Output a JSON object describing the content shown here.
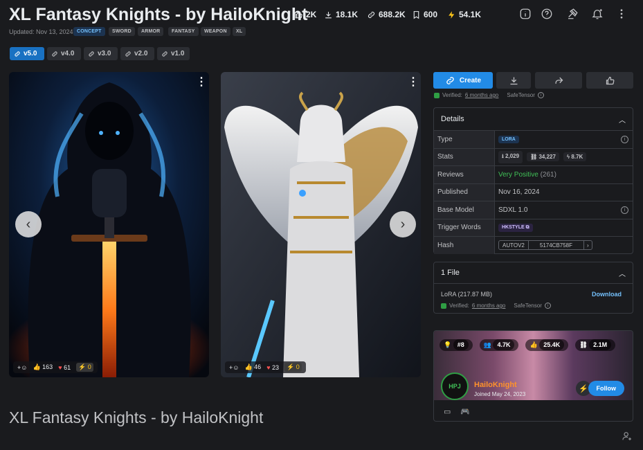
{
  "header": {
    "title": "XL Fantasy Knights - by HailoKnight",
    "stats": {
      "likes": "2K",
      "downloads": "18.1K",
      "generations": "688.2K",
      "bookmarks": "600",
      "buzz": "54.1K"
    },
    "updated": "Updated: Nov 13, 2024",
    "tags": [
      "CONCEPT",
      "SWORD",
      "ARMOR",
      "FANTASY",
      "WEAPON",
      "XL"
    ]
  },
  "versions": [
    "v5.0",
    "v4.0",
    "v3.0",
    "v2.0",
    "v1.0"
  ],
  "gallery": {
    "images": [
      {
        "likes": "163",
        "hearts": "61",
        "buzz": "0"
      },
      {
        "likes": "46",
        "hearts": "23",
        "buzz": "0"
      }
    ]
  },
  "actions": {
    "create": "Create"
  },
  "verified": {
    "label": "Verified:",
    "when": "6 months ago",
    "format": "SafeTensor"
  },
  "details": {
    "heading": "Details",
    "type_label": "Type",
    "type_value": "LORA",
    "stats_label": "Stats",
    "stats_downloads": "2,029",
    "stats_generations": "34,227",
    "stats_buzz": "8.7K",
    "reviews_label": "Reviews",
    "reviews_value": "Very Positive",
    "reviews_count": "(261)",
    "published_label": "Published",
    "published_value": "Nov 16, 2024",
    "base_label": "Base Model",
    "base_value": "SDXL 1.0",
    "trigger_label": "Trigger Words",
    "trigger_value": "HKSTYLE",
    "hash_label": "Hash",
    "hash_type": "AUTOV2",
    "hash_value": "5174CB758F"
  },
  "files": {
    "heading": "1 File",
    "name": "LoRA (217.87 MB)",
    "download": "Download",
    "verified_label": "Verified:",
    "verified_when": "6 months ago",
    "format": "SafeTensor"
  },
  "creator": {
    "rank": "#8",
    "followers": "4.7K",
    "likes": "25.4K",
    "downloads": "2.1M",
    "name": "HailoKnight",
    "joined": "Joined May 24, 2023",
    "follow": "Follow",
    "avatar_text": "HPJ"
  },
  "footer_title": "XL Fantasy Knights - by HailoKnight",
  "colors": {
    "accent": "#228be6",
    "positive": "#40c057",
    "creator_name": "#ff922b"
  }
}
